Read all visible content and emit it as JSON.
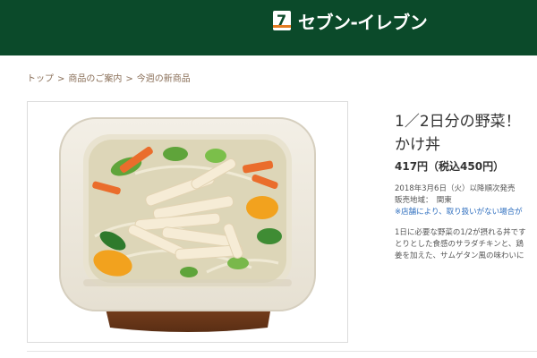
{
  "header": {
    "logo_text": "セブン-イレブン",
    "colors": {
      "background": "#0b4a2a",
      "logo_stripe": "#e37b22"
    }
  },
  "breadcrumb": {
    "items": [
      "トップ",
      "商品のご案内",
      "今週の新商品"
    ],
    "separator": ">"
  },
  "product": {
    "image_alt": "1／2日分の野菜！かけ丼",
    "title_line1": "1／2日分の野菜！",
    "title_line2": "かけ丼",
    "price": "417円（税込450円）",
    "release": "2018年3月6日（火）以降順次発売",
    "region": "販売地域：　関東",
    "note": "※店舗により、取り扱いがない場合が",
    "description": [
      "1日に必要な野菜の1/2が摂れる丼です",
      "とりとした食感のサラダチキンと、鶏",
      "姜を加えた、サムゲタン風の味わいに"
    ]
  }
}
